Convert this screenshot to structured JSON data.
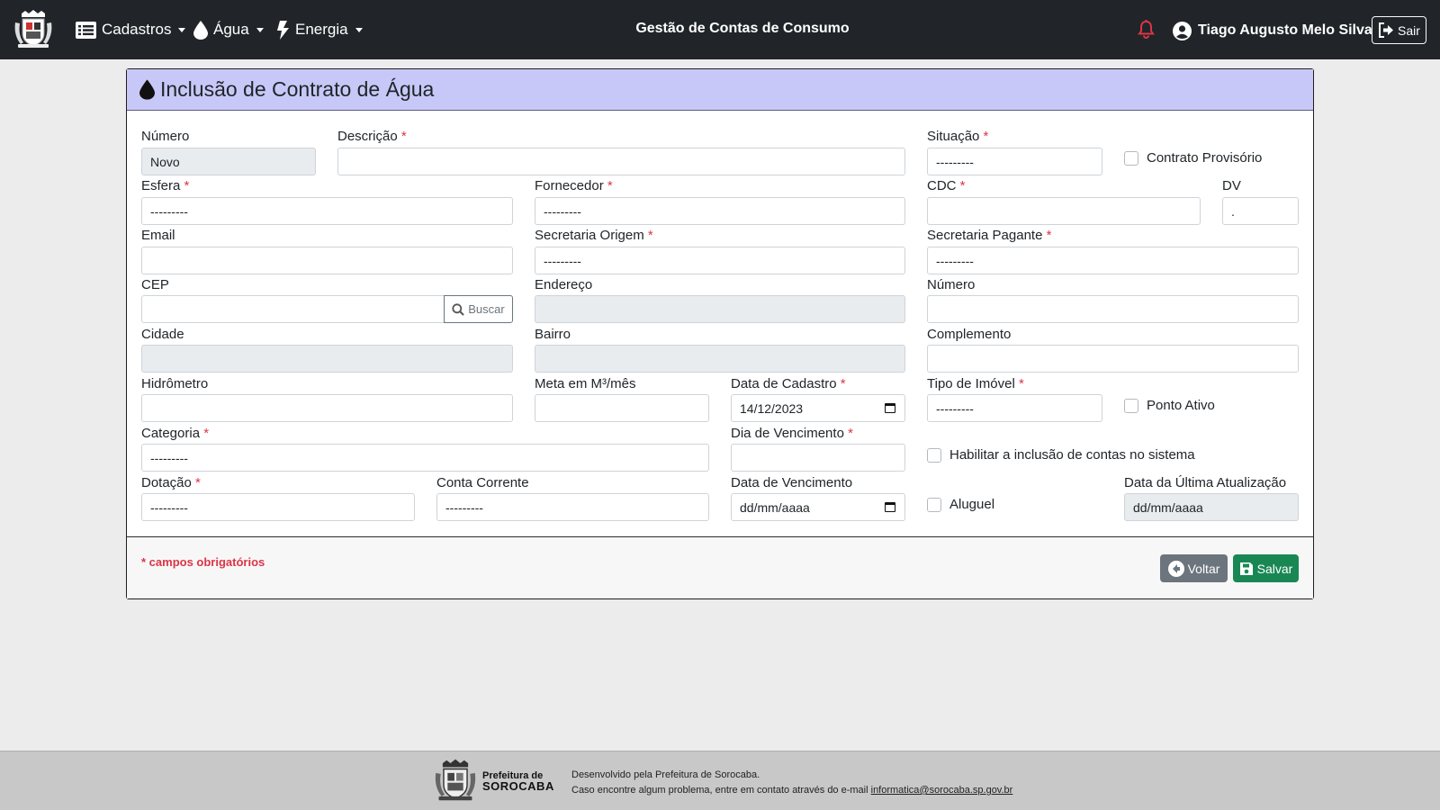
{
  "nav": {
    "menu": [
      {
        "label": "Cadastros"
      },
      {
        "label": "Água"
      },
      {
        "label": "Energia"
      }
    ],
    "title": "Gestão de Contas de Consumo",
    "user": "Tiago Augusto Melo Silva",
    "logout": "Sair"
  },
  "card": {
    "title": "Inclusão de Contrato de Água",
    "header_color": "#c8c8f8"
  },
  "form": {
    "numero": {
      "label": "Número",
      "value": "Novo"
    },
    "descricao": {
      "label": "Descrição",
      "value": ""
    },
    "situacao": {
      "label": "Situação",
      "value": "---------"
    },
    "contrato_provisorio": {
      "label": "Contrato Provisório"
    },
    "esfera": {
      "label": "Esfera",
      "value": "---------"
    },
    "fornecedor": {
      "label": "Fornecedor",
      "value": "---------"
    },
    "cdc": {
      "label": "CDC",
      "value": ""
    },
    "dv": {
      "label": "DV",
      "value": "."
    },
    "email": {
      "label": "Email",
      "value": ""
    },
    "secretaria_origem": {
      "label": "Secretaria Origem",
      "value": "---------"
    },
    "secretaria_pagante": {
      "label": "Secretaria Pagante",
      "value": "---------"
    },
    "cep": {
      "label": "CEP",
      "value": "",
      "button": "Buscar"
    },
    "endereco": {
      "label": "Endereço",
      "value": ""
    },
    "numero_end": {
      "label": "Número",
      "value": ""
    },
    "cidade": {
      "label": "Cidade",
      "value": ""
    },
    "bairro": {
      "label": "Bairro",
      "value": ""
    },
    "complemento": {
      "label": "Complemento",
      "value": ""
    },
    "hidrometro": {
      "label": "Hidrômetro",
      "value": ""
    },
    "meta": {
      "label": "Meta em M³/mês",
      "value": ""
    },
    "data_cadastro": {
      "label": "Data de Cadastro",
      "value": "14/12/2023"
    },
    "tipo_imovel": {
      "label": "Tipo de Imóvel",
      "value": "---------"
    },
    "ponto_ativo": {
      "label": "Ponto Ativo"
    },
    "categoria": {
      "label": "Categoria",
      "value": "---------"
    },
    "dia_vencimento": {
      "label": "Dia de Vencimento",
      "value": ""
    },
    "habilitar": {
      "label": "Habilitar a inclusão de contas no sistema"
    },
    "dotacao": {
      "label": "Dotação",
      "value": "---------"
    },
    "conta_corrente": {
      "label": "Conta Corrente",
      "value": "---------"
    },
    "data_vencimento": {
      "label": "Data de Vencimento",
      "value": "dd/mm/aaaa"
    },
    "aluguel": {
      "label": "Aluguel"
    },
    "ultima_atualizacao": {
      "label": "Data da Última Atualização",
      "value": "dd/mm/aaaa"
    },
    "required_marker": "*"
  },
  "actions": {
    "required_note": "* campos obrigatórios",
    "back": "Voltar",
    "save": "Salvar"
  },
  "footer": {
    "brand_line1": "Prefeitura de",
    "brand_line2": "SOROCABA",
    "developed": "Desenvolvido pela Prefeitura de Sorocaba.",
    "contact": "Caso encontre algum problema, entre em contato através do e-mail",
    "email": "informatica@sorocaba.sp.gov.br"
  },
  "colors": {
    "navbar": "#212529",
    "required": "#dc3545",
    "save": "#198754",
    "back": "#6c757d"
  }
}
